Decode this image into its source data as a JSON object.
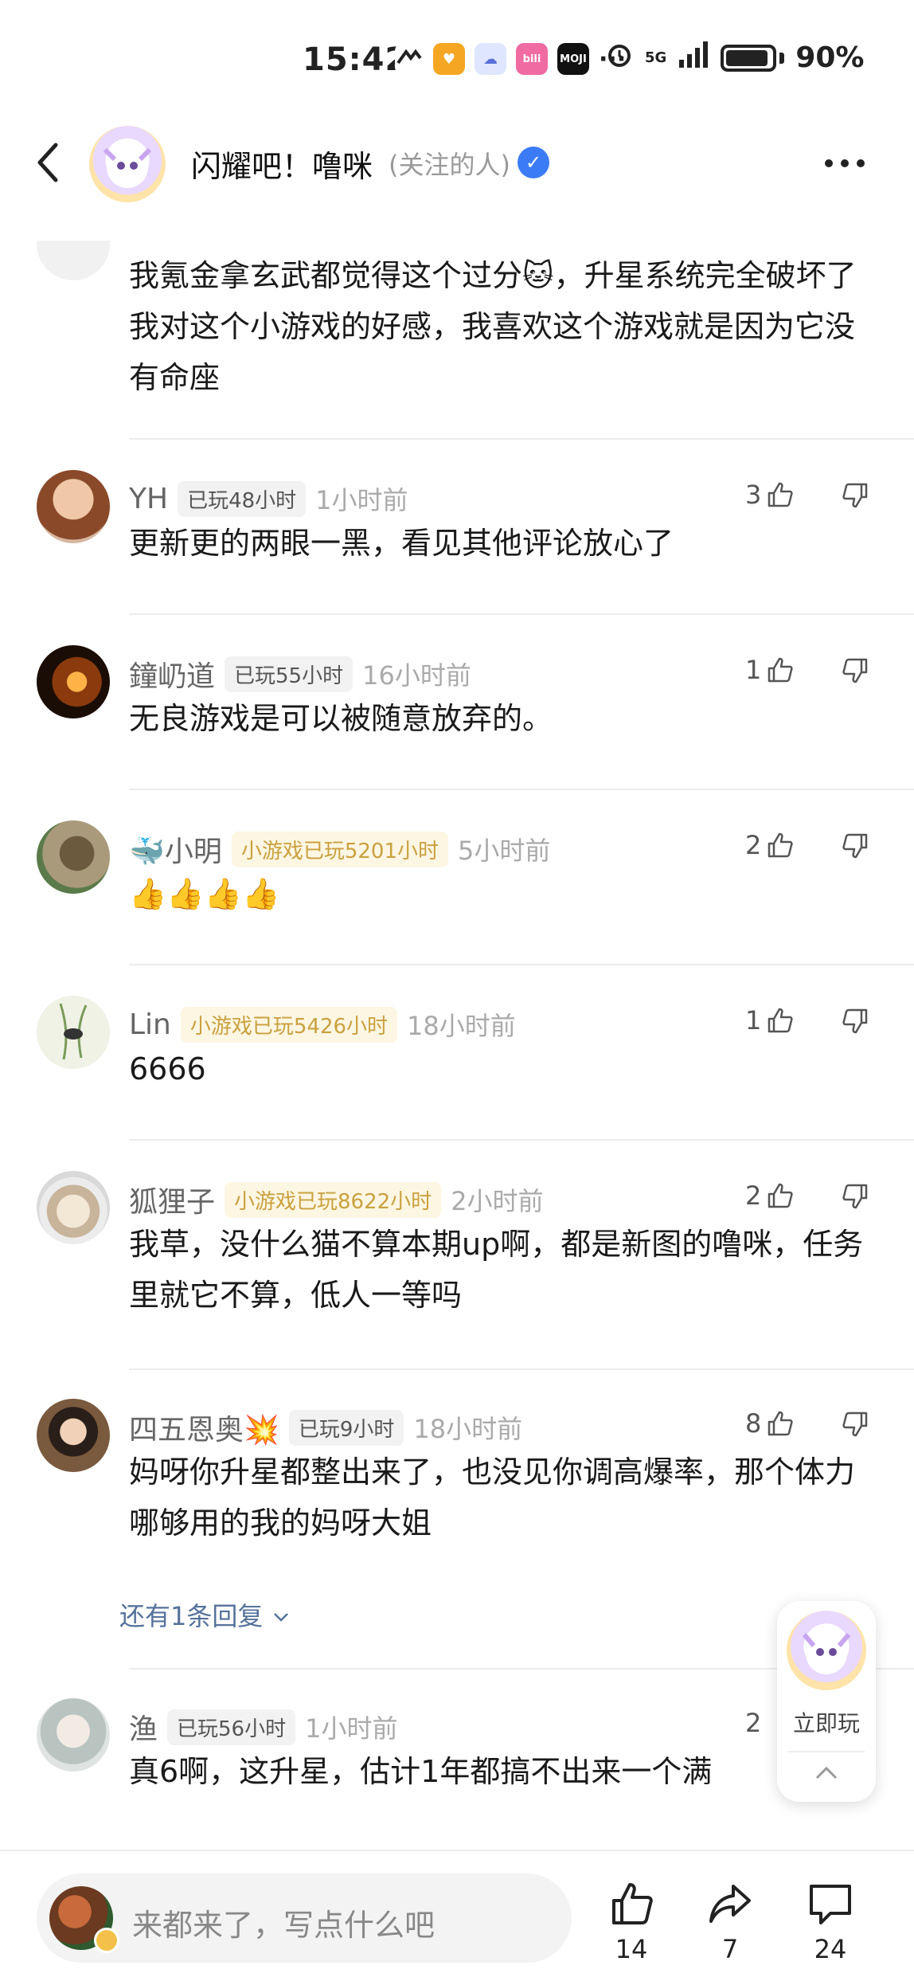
{
  "status_bar": {
    "time": "15:42",
    "network": "5G",
    "battery": "90%",
    "overflow": "···"
  },
  "header": {
    "title": "闪耀吧！噜咪",
    "subtitle": "(关注的人)"
  },
  "comments": [
    {
      "name": "",
      "badge": "",
      "time": "",
      "text": "我氪金拿玄武都觉得这个过分🐱，升星系统完全破坏了我对这个小游戏的好感，我喜欢这个游戏就是因为它没有命座",
      "likes": ""
    },
    {
      "name": "YH",
      "badge": "已玩48小时",
      "time": "1小时前",
      "text": "更新更的两眼一黑，看见其他评论放心了",
      "likes": "3"
    },
    {
      "name": "鐘屷道",
      "badge": "已玩55小时",
      "time": "16小时前",
      "text": "无良游戏是可以被随意放弃的。",
      "likes": "1"
    },
    {
      "name": "🐳小明",
      "badge": "小游戏已玩5201小时",
      "time": "5小时前",
      "text": "👍👍👍👍",
      "likes": "2"
    },
    {
      "name": "Lin",
      "badge": "小游戏已玩5426小时",
      "time": "18小时前",
      "text": "6666",
      "likes": "1"
    },
    {
      "name": "狐狸子",
      "badge": "小游戏已玩8622小时",
      "time": "2小时前",
      "text": "我草，没什么猫不算本期up啊，都是新图的噜咪，任务里就它不算，低人一等吗",
      "likes": "2"
    },
    {
      "name": "四五恩奥💥",
      "badge": "已玩9小时",
      "time": "18小时前",
      "text": "妈呀你升星都整出来了，也没见你调高爆率，那个体力哪够用的我的妈呀大姐",
      "likes": "8"
    },
    {
      "name": "渔",
      "badge": "已玩56小时",
      "time": "1小时前",
      "text": "真6啊，这升星，估计1年都搞不出来一个满",
      "likes": "2"
    }
  ],
  "more_replies": "还有1条回复",
  "float_widget": {
    "label": "立即玩"
  },
  "bottom_bar": {
    "placeholder": "来都来了，写点什么吧",
    "like_count": "14",
    "share_count": "7",
    "comment_count": "24"
  },
  "colors": {
    "gold_badge_text": "#c9a13e",
    "gold_badge_bg": "#fdf6e3",
    "link": "#56729b",
    "verified": "#3b7cf6"
  }
}
